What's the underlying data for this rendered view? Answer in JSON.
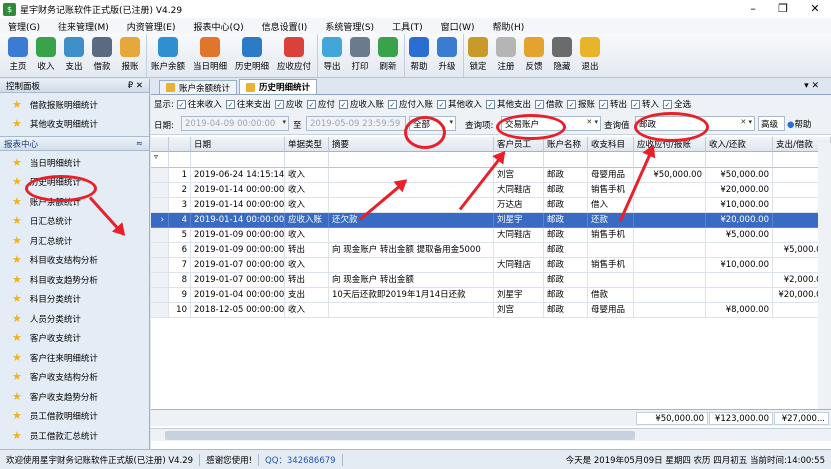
{
  "window": {
    "title": "星宇财务记账软件正式版(已注册) V4.29"
  },
  "menu": [
    "管理(G)",
    "往来管理(M)",
    "内资管理(E)",
    "报表中心(Q)",
    "信息设置(I)",
    "系统管理(S)",
    "工具(T)",
    "窗口(W)",
    "帮助(H)"
  ],
  "toolbar": [
    {
      "label": "主页",
      "icon": "home-icon",
      "color": "#3b7bd4"
    },
    {
      "label": "收入",
      "icon": "income-icon",
      "color": "#39a34a"
    },
    {
      "label": "支出",
      "icon": "expense-icon",
      "color": "#3f8fc8"
    },
    {
      "label": "借款",
      "icon": "loan-icon",
      "color": "#5a6a83"
    },
    {
      "label": "报账",
      "icon": "reimburse-icon",
      "color": "#e6a83a"
    },
    {
      "label": "账户余额",
      "icon": "balance-icon",
      "color": "#2f8fd0"
    },
    {
      "label": "当日明细",
      "icon": "daily-detail-icon",
      "color": "#e0762b"
    },
    {
      "label": "历史明细",
      "icon": "history-detail-icon",
      "color": "#2d7ac7"
    },
    {
      "label": "应收应付",
      "icon": "receivable-icon",
      "color": "#d9423a"
    },
    {
      "label": "导出",
      "icon": "export-icon",
      "color": "#43a6d8"
    },
    {
      "label": "打印",
      "icon": "print-icon",
      "color": "#6b7a8c"
    },
    {
      "label": "刷新",
      "icon": "refresh-icon",
      "color": "#3aa24a"
    },
    {
      "label": "帮助",
      "icon": "help-icon",
      "color": "#2a6ed1"
    },
    {
      "label": "升级",
      "icon": "upgrade-icon",
      "color": "#3a7dd0"
    },
    {
      "label": "锁定",
      "icon": "lock-icon",
      "color": "#c79a2a"
    },
    {
      "label": "注册",
      "icon": "register-icon",
      "color": "#b5b5b5"
    },
    {
      "label": "反馈",
      "icon": "feedback-icon",
      "color": "#e4a32e"
    },
    {
      "label": "隐藏",
      "icon": "hide-icon",
      "color": "#6b6b6b"
    },
    {
      "label": "退出",
      "icon": "exit-icon",
      "color": "#e8b52a"
    }
  ],
  "left": {
    "panel_title": "控制面板",
    "panel_pin": "₽ ✕",
    "top_items": [
      "借款报账明细统计",
      "其他收支明细统计"
    ],
    "section_title": "报表中心",
    "section_toggle": "≈",
    "items": [
      "当日明细统计",
      "历史明细统计",
      "账户余额统计",
      "日汇总统计",
      "月汇总统计",
      "科目收支结构分析",
      "科目收支趋势分析",
      "科目分类统计",
      "人员分类统计",
      "客户收支统计",
      "客户往来明细统计",
      "客户收支结构分析",
      "客户收支趋势分析",
      "员工借款明细统计",
      "员工借款汇总统计"
    ]
  },
  "tabs": [
    "账户余额统计",
    "历史明细统计"
  ],
  "tab_close": "▾ ✕",
  "show": {
    "label": "显示:",
    "options": [
      "往来收入",
      "往来支出",
      "应收",
      "应付",
      "应收入账",
      "应付入账",
      "其他收入",
      "其他支出",
      "借款",
      "报账",
      "转出",
      "转入",
      "全选"
    ]
  },
  "filter": {
    "date_label": "日期:",
    "date_from": "2019-04-09 00:00:00",
    "to_label": "至",
    "date_to": "2019-05-09 23:59:59",
    "scope_value": "全部",
    "query_label": "查询项:",
    "query_value": "交易账户",
    "value_label": "查询值",
    "value_value": "邮政",
    "advanced": "高级",
    "help": "帮助"
  },
  "grid": {
    "columns": [
      "日期",
      "单据类型",
      "摘要",
      "客户员工",
      "账户名称",
      "收支科目",
      "应收应付/报账",
      "收入/还款",
      "支出/借款"
    ],
    "rows": [
      {
        "no": "1",
        "date": "2019-06-24 14:15:14",
        "type": "收入",
        "summary": "",
        "person": "刘宫",
        "account": "邮政",
        "subject": "母婴用品",
        "recv": "¥50,000.00",
        "income": "¥50,000.00",
        "expense": ""
      },
      {
        "no": "2",
        "date": "2019-01-14 00:00:00",
        "type": "收入",
        "summary": "",
        "person": "大同鞋店",
        "account": "邮政",
        "subject": "销售手机",
        "recv": "",
        "income": "¥20,000.00",
        "expense": ""
      },
      {
        "no": "3",
        "date": "2019-01-14 00:00:00",
        "type": "收入",
        "summary": "",
        "person": "万达店",
        "account": "邮政",
        "subject": "借入",
        "recv": "",
        "income": "¥10,000.00",
        "expense": ""
      },
      {
        "no": "4",
        "date": "2019-01-14 00:00:00",
        "type": "应收入账",
        "summary": "还欠款",
        "person": "刘星宇",
        "account": "邮政",
        "subject": "还款",
        "recv": "",
        "income": "¥20,000.00",
        "expense": "",
        "selected": true
      },
      {
        "no": "5",
        "date": "2019-01-09 00:00:00",
        "type": "收入",
        "summary": "",
        "person": "大同鞋店",
        "account": "邮政",
        "subject": "销售手机",
        "recv": "",
        "income": "¥5,000.00",
        "expense": ""
      },
      {
        "no": "6",
        "date": "2019-01-09 00:00:00",
        "type": "转出",
        "summary": "向 现金账户 转出金额 提取备用金5000",
        "person": "",
        "account": "邮政",
        "subject": "",
        "recv": "",
        "income": "",
        "expense": "¥5,000.00"
      },
      {
        "no": "7",
        "date": "2019-01-07 00:00:00",
        "type": "收入",
        "summary": "",
        "person": "大同鞋店",
        "account": "邮政",
        "subject": "销售手机",
        "recv": "",
        "income": "¥10,000.00",
        "expense": ""
      },
      {
        "no": "8",
        "date": "2019-01-07 00:00:00",
        "type": "转出",
        "summary": "向 现金账户 转出金额",
        "person": "",
        "account": "邮政",
        "subject": "",
        "recv": "",
        "income": "",
        "expense": "¥2,000.00"
      },
      {
        "no": "9",
        "date": "2019-01-04 00:00:00",
        "type": "支出",
        "summary": "10天后还款即2019年1月14日还款",
        "person": "刘星宇",
        "account": "邮政",
        "subject": "借款",
        "recv": "",
        "income": "",
        "expense": "¥20,000.00"
      },
      {
        "no": "10",
        "date": "2018-12-05 00:00:00",
        "type": "收入",
        "summary": "",
        "person": "刘宫",
        "account": "邮政",
        "subject": "母婴用品",
        "recv": "",
        "income": "¥8,000.00",
        "expense": ""
      }
    ],
    "totals": {
      "recv": "¥50,000.00",
      "income": "¥123,000.00",
      "expense": "¥27,000..."
    }
  },
  "status": {
    "welcome": "欢迎使用星宇财务记账软件正式版(已注册) V4.29",
    "thanks": "感谢您使用!",
    "qq": "QQ：342686679",
    "today": "今天是 2019年05月09日 星期四 农历 四月初五 当前时间:14:00:55"
  }
}
